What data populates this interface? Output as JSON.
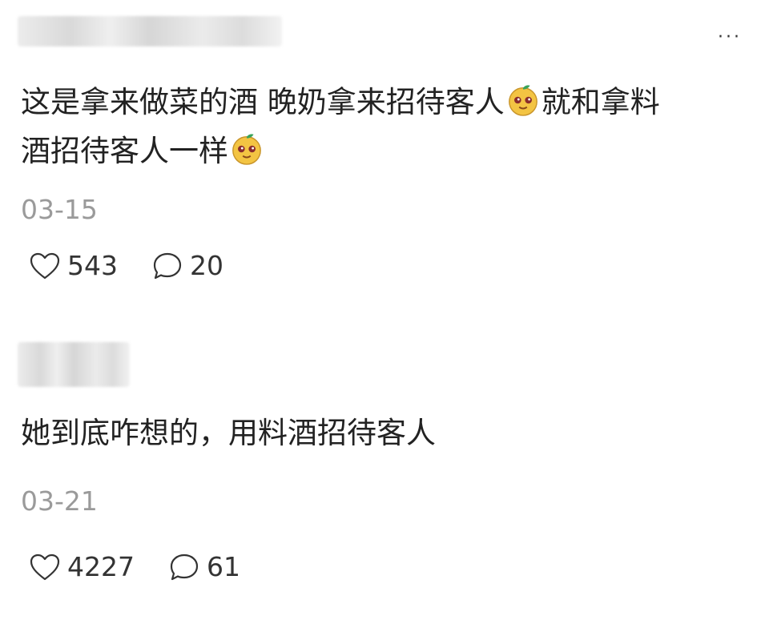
{
  "comments": [
    {
      "text_parts": [
        "这是拿来做菜的酒 晚奶拿来招待客人",
        "就和拿料",
        "酒招待客人一样"
      ],
      "emoji": "peach-face-emoji",
      "date": "03-15",
      "likes": "543",
      "replies": "20"
    },
    {
      "text": "她到底咋想的，用料酒招待客人",
      "date": "03-21",
      "likes": "4227",
      "replies": "61"
    }
  ],
  "more_label": "···",
  "icons": {
    "like": "heart-icon",
    "reply": "comment-bubble-icon",
    "more": "more-icon"
  },
  "colors": {
    "text": "#222222",
    "meta": "#9a9a9a",
    "emoji_face": "#f3c443"
  }
}
